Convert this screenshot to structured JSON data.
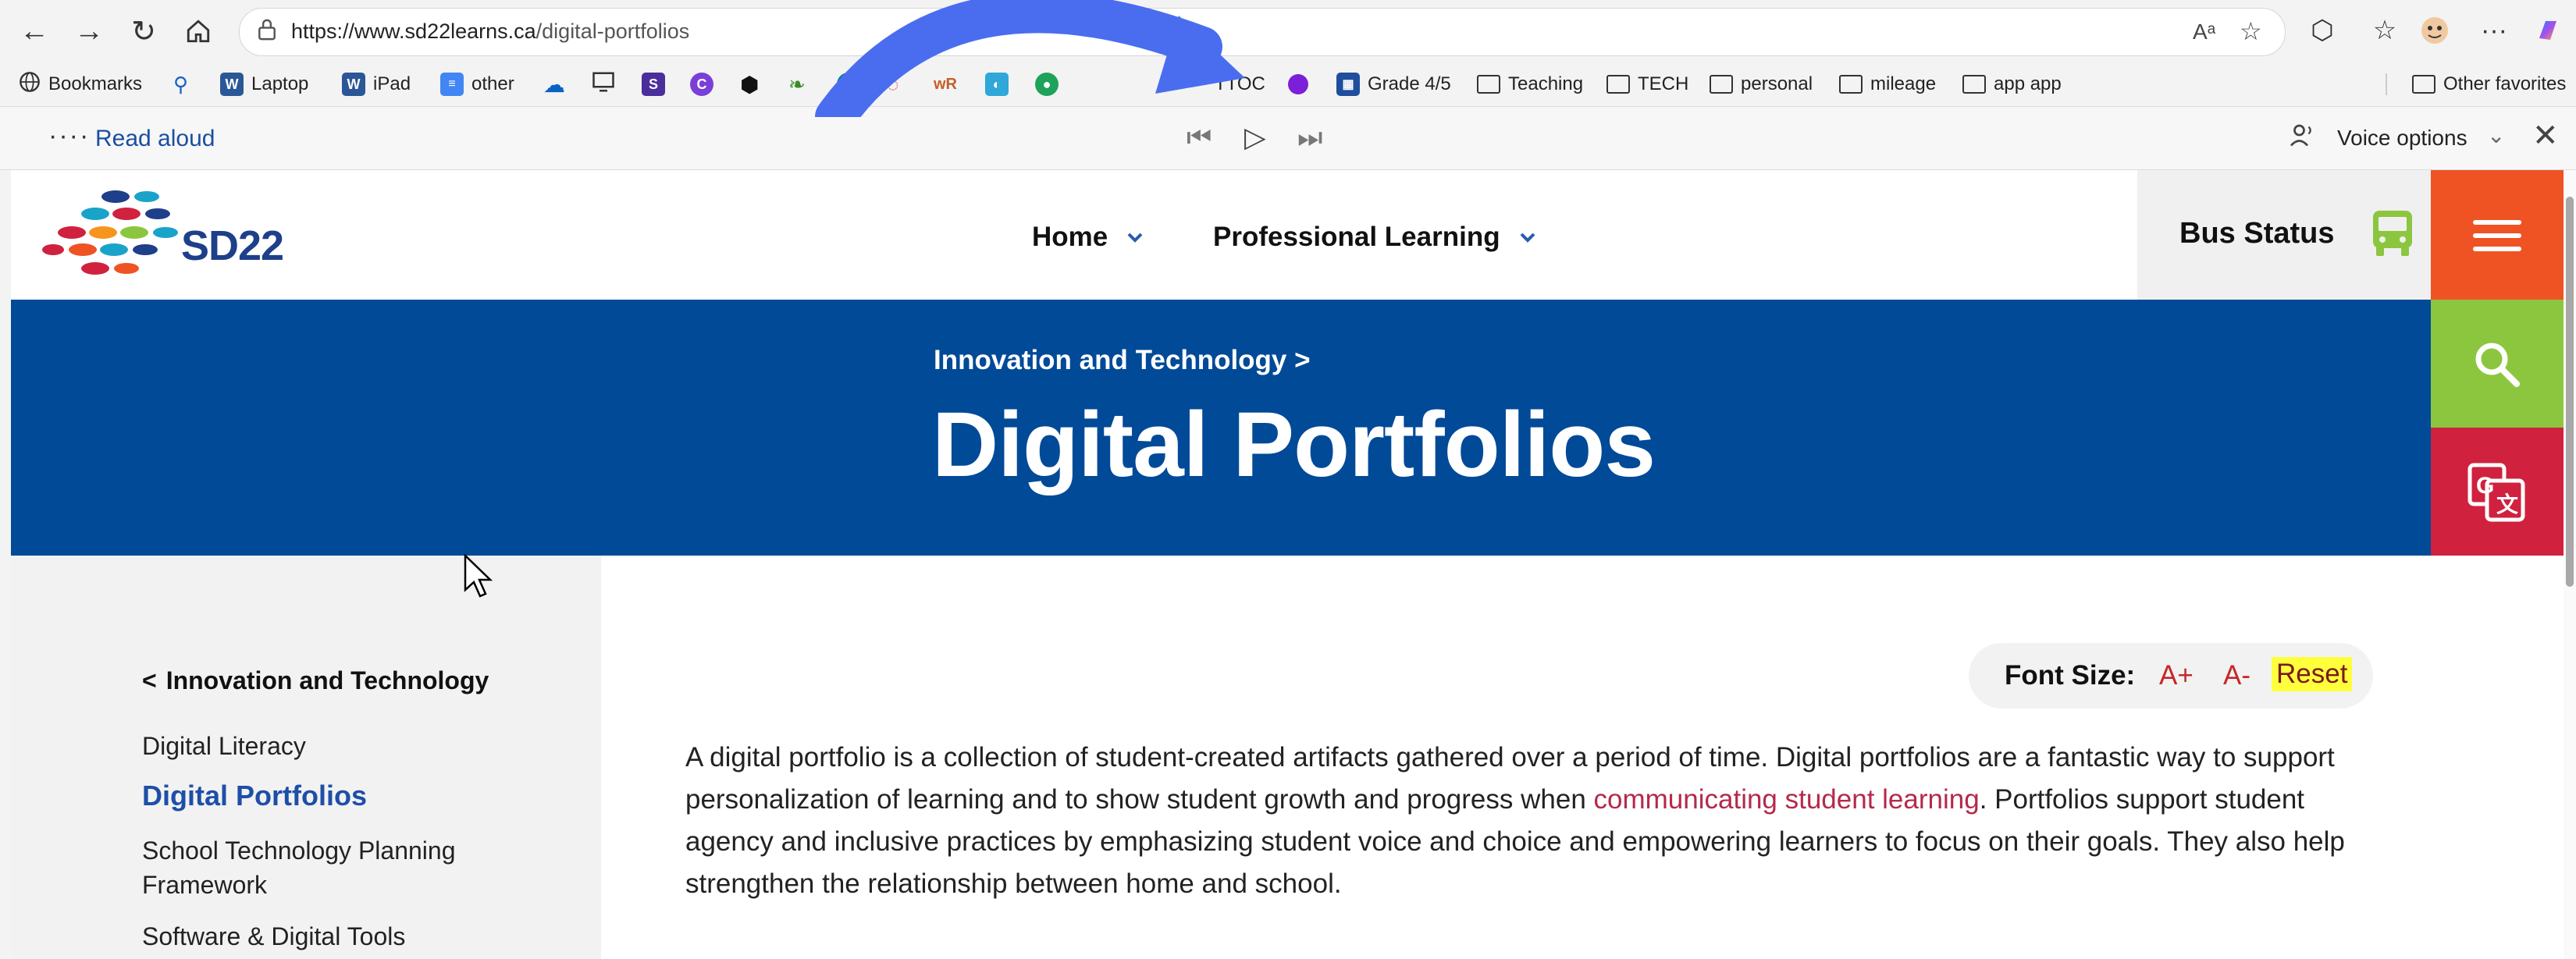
{
  "browser": {
    "url_host": "https://www.sd22learns.ca",
    "url_path": "/digital-portfolios",
    "read_aloud_icon": "Aᵃ",
    "icons": [
      "back-icon",
      "forward-icon",
      "refresh-icon",
      "home-icon",
      "lock-icon",
      "read-aloud-icon",
      "star-icon",
      "extensions-icon",
      "favorites-icon",
      "profile-icon",
      "more-icon",
      "copilot-icon"
    ]
  },
  "bookmarks": [
    {
      "label": "Bookmarks",
      "icon": "globe-icon"
    },
    {
      "label": "",
      "icon": "search-icon"
    },
    {
      "label": "Laptop",
      "icon": "word-icon"
    },
    {
      "label": "iPad",
      "icon": "word-icon"
    },
    {
      "label": "other",
      "icon": "docs-icon"
    },
    {
      "label": "",
      "icon": "onedrive-icon"
    },
    {
      "label": "",
      "icon": "monitor-icon"
    },
    {
      "label": "",
      "icon": "s-app-icon"
    },
    {
      "label": "",
      "icon": "c-app-icon"
    },
    {
      "label": "",
      "icon": "hex-icon"
    },
    {
      "label": "",
      "icon": "leaf-icon"
    },
    {
      "label": "",
      "icon": "sharepoint-icon"
    },
    {
      "label": "",
      "icon": "swirl-icon"
    },
    {
      "label": "",
      "icon": "wr-icon"
    },
    {
      "label": "",
      "icon": "chart-app-icon"
    },
    {
      "label": "",
      "icon": "green-app-icon"
    },
    {
      "label": "TTOC",
      "icon": ""
    },
    {
      "label": "",
      "icon": "purple-dot-icon"
    },
    {
      "label": "Grade 4/5",
      "icon": "calendar-icon"
    },
    {
      "label": "Teaching",
      "icon": "folder-icon"
    },
    {
      "label": "TECH",
      "icon": "folder-icon"
    },
    {
      "label": "personal",
      "icon": "folder-icon"
    },
    {
      "label": "mileage",
      "icon": "folder-icon"
    },
    {
      "label": "app app",
      "icon": "folder-icon"
    },
    {
      "label": "Other favorites",
      "icon": "folder-icon"
    }
  ],
  "read_aloud": {
    "dots": "····",
    "label": "Read aloud",
    "voice_options": "Voice options",
    "controls": [
      "previous-icon",
      "play-icon",
      "next-icon"
    ]
  },
  "site": {
    "logo_text": "SD22",
    "nav": [
      {
        "label": "Home"
      },
      {
        "label": "Professional Learning"
      }
    ],
    "bus_status": "Bus Status",
    "accent_colors": {
      "menu": "#ef5323",
      "search": "#8cc63f",
      "translate": "#d0213f",
      "banner": "#004a98"
    }
  },
  "banner": {
    "breadcrumb": "Innovation and Technology",
    "title": "Digital Portfolios"
  },
  "sidebar": {
    "back_label": "Innovation and Technology",
    "items": [
      {
        "label": "Digital Literacy"
      },
      {
        "label": "Digital Portfolios",
        "active": true
      },
      {
        "label": "School Technology Planning Framework"
      },
      {
        "label": "Software & Digital Tools"
      }
    ]
  },
  "font_size": {
    "label": "Font Size:",
    "increase": "A+",
    "decrease": "A-",
    "reset": "Reset"
  },
  "content": {
    "intro_before": "A digital portfolio is a collection of student-created artifacts gathered over a period of time. Digital portfolios are a fantastic way to support personalization of learning and to show student growth and progress when ",
    "intro_link": "communicating student learning",
    "intro_after": ".  Portfolios support student agency and inclusive practices by emphasizing student voice and choice and empowering learners to focus on their goals. They also help strengthen the relationship between home and school."
  }
}
